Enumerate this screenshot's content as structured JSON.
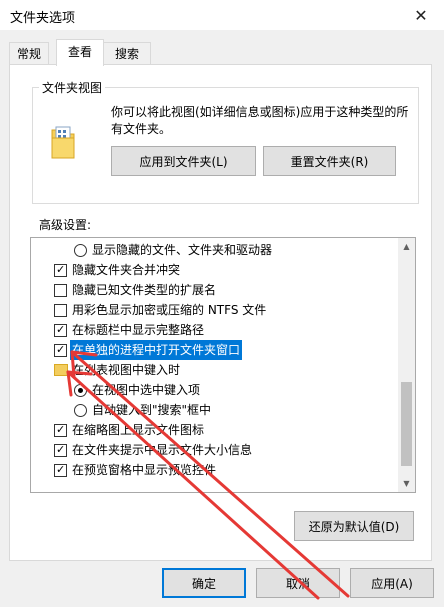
{
  "window": {
    "title": "文件夹选项"
  },
  "tabs": [
    {
      "label": "常规"
    },
    {
      "label": "查看"
    },
    {
      "label": "搜索"
    }
  ],
  "folder_views": {
    "label": "文件夹视图",
    "description": "你可以将此视图(如详细信息或图标)应用于这种类型的所有文件夹。",
    "apply_button": "应用到文件夹(L)",
    "reset_button": "重置文件夹(R)"
  },
  "advanced": {
    "label": "高级设置:",
    "items": [
      {
        "type": "radio",
        "label": "显示隐藏的文件、文件夹和驱动器",
        "checked": false
      },
      {
        "type": "checkbox",
        "label": "隐藏文件夹合并冲突",
        "checked": true
      },
      {
        "type": "checkbox",
        "label": "隐藏已知文件类型的扩展名",
        "checked": false
      },
      {
        "type": "checkbox",
        "label": "用彩色显示加密或压缩的 NTFS 文件",
        "checked": false
      },
      {
        "type": "checkbox",
        "label": "在标题栏中显示完整路径",
        "checked": true
      },
      {
        "type": "checkbox",
        "label": "在单独的进程中打开文件夹窗口",
        "checked": true,
        "highlighted": true
      },
      {
        "type": "folder",
        "label": "在列表视图中键入时"
      },
      {
        "type": "radio",
        "label": "在视图中选中键入项",
        "checked": true
      },
      {
        "type": "radio",
        "label": "自动键入到\"搜索\"框中",
        "checked": false
      },
      {
        "type": "checkbox",
        "label": "在缩略图上显示文件图标",
        "checked": true
      },
      {
        "type": "checkbox",
        "label": "在文件夹提示中显示文件大小信息",
        "checked": true
      },
      {
        "type": "checkbox",
        "label": "在预览窗格中显示预览控件",
        "checked": true
      }
    ],
    "restore_button": "还原为默认值(D)"
  },
  "footer": {
    "ok": "确定",
    "cancel": "取消",
    "apply": "应用(A)"
  }
}
